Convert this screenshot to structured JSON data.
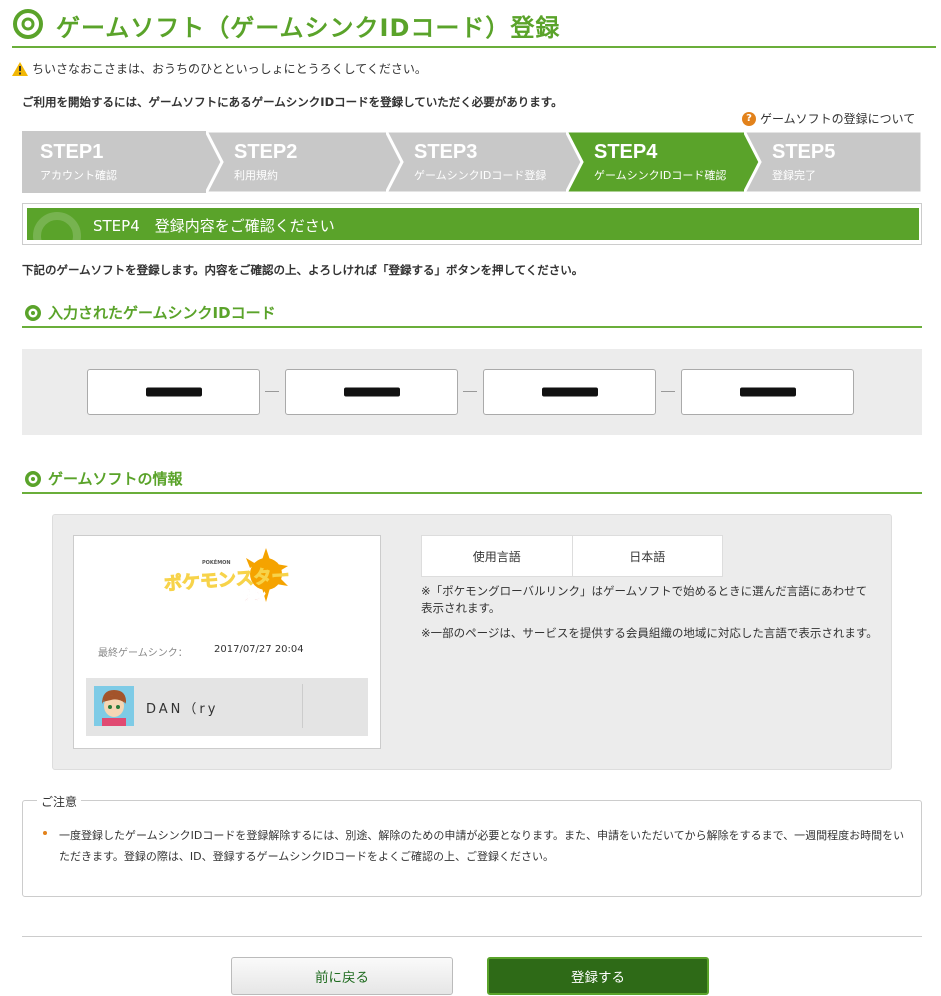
{
  "header": {
    "title": "ゲームソフト（ゲームシンクIDコード）登録"
  },
  "warning": "ちいさなおこさまは、おうちのひとといっしょにとうろくしてください。",
  "intro": "ご利用を開始するには、ゲームソフトにあるゲームシンクIDコードを登録していただく必要があります。",
  "help_link": "ゲームソフトの登録について",
  "steps": [
    {
      "num": "STEP1",
      "label": "アカウント確認",
      "active": false
    },
    {
      "num": "STEP2",
      "label": "利用規約",
      "active": false
    },
    {
      "num": "STEP3",
      "label": "ゲームシンクIDコード登録",
      "active": false
    },
    {
      "num": "STEP4",
      "label": "ゲームシンクIDコード確認",
      "active": true
    },
    {
      "num": "STEP5",
      "label": "登録完了",
      "active": false
    }
  ],
  "banner": "STEP4　登録内容をご確認ください",
  "description": "下記のゲームソフトを登録します。内容をご確認の上、よろしければ「登録する」ボタンを押してください。",
  "code_section": {
    "title": "入力されたゲームシンクIDコード"
  },
  "info_section": {
    "title": "ゲームソフトの情報"
  },
  "game": {
    "logo_title": "ポケモンスター",
    "logo_subtitle": "サン",
    "logo_brand": "POKÉMON",
    "last_sync_label": "最終ゲームシンク：",
    "last_sync_value": "2017/07/27 20:04",
    "player_name": "DAN（ry"
  },
  "language": {
    "label": "使用言語",
    "value": "日本語"
  },
  "notes": [
    "※「ポケモングローバルリンク」はゲームソフトで始めるときに選んだ言語にあわせて表示されます。",
    "※一部のページは、サービスを提供する会員組織の地域に対応した言語で表示されます。"
  ],
  "caution": {
    "title": "ご注意",
    "body": "一度登録したゲームシンクIDコードを登録解除するには、別途、解除のための申請が必要となります。また、申請をいただいてから解除をするまで、一週間程度お時間をいただきます。登録の際は、ID、登録するゲームシンクIDコードをよくご確認の上、ご登録ください。"
  },
  "buttons": {
    "back": "前に戻る",
    "submit": "登録する"
  },
  "colors": {
    "accent": "#5aa32a",
    "step_inactive": "#c8c8c8",
    "submit": "#2e6a17",
    "warning": "#e2821b"
  },
  "icons": {
    "header": "pokeball-icon",
    "warning": "warning-icon",
    "help": "question-icon",
    "section": "pokeball-icon"
  }
}
